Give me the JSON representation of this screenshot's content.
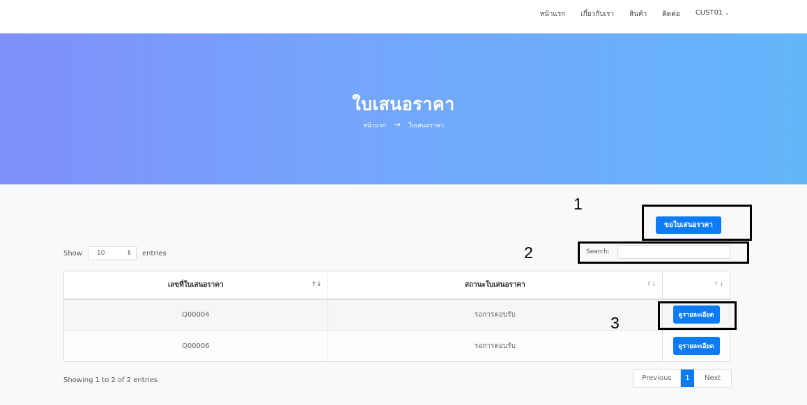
{
  "nav": {
    "items": [
      "หน้าแรก",
      "เกี่ยวกับเรา",
      "สินค้า",
      "ติดต่อ"
    ],
    "user": "CUST01"
  },
  "hero": {
    "title": "ใบเสนอราคา",
    "breadcrumb_home": "หน้าแรก",
    "breadcrumb_current": "ใบเสนอราคา"
  },
  "annotations": {
    "m1": "1",
    "m2": "2",
    "m3": "3"
  },
  "actions": {
    "request_quote": "ขอใบเสนอราคา"
  },
  "table_controls": {
    "show_label": "Show",
    "page_size": "10",
    "entries_label": "entries",
    "search_label": "Search:"
  },
  "table": {
    "columns": [
      "เลขที่ใบเสนอราคา",
      "สถานะใบเสนอราคา",
      ""
    ],
    "rows": [
      {
        "number": "Q00004",
        "status": "รอการตอบรับ",
        "action": "ดูรายละเอียด"
      },
      {
        "number": "Q00006",
        "status": "รอการตอบรับ",
        "action": "ดูรายละเอียด"
      }
    ]
  },
  "footer": {
    "info": "Showing 1 to 2 of 2 entries",
    "previous": "Previous",
    "page": "1",
    "next": "Next"
  },
  "colors": {
    "primary": "#0d7bf5",
    "hero_start": "#7f8ffb",
    "hero_end": "#64b6fb"
  }
}
